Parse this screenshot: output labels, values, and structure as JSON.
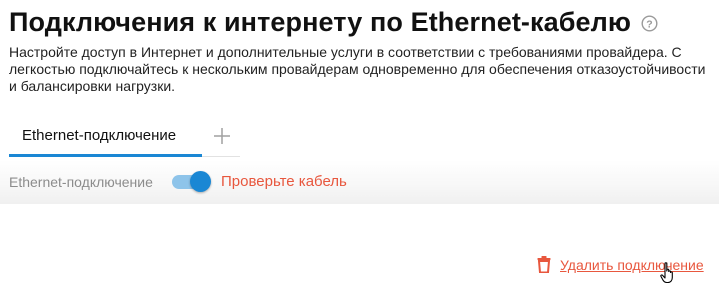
{
  "header": {
    "title": "Подключения к интернету по Ethernet-кабелю",
    "help_icon": "help-circle-icon",
    "description": "Настройте доступ в Интернет и дополнительные услуги в соответствии с требованиями провайдера. С легкостью подключайтесь к нескольким провайдерам одновременно для обеспечения отказоустойчивости и балансировки нагрузки."
  },
  "tabs": {
    "items": [
      {
        "label": "Ethernet-подключение",
        "active": true
      }
    ],
    "add_icon": "plus-icon"
  },
  "connection": {
    "label": "Ethernet-подключение",
    "enabled": true,
    "status_text": "Проверьте кабель"
  },
  "actions": {
    "delete_label": "Удалить подключение",
    "delete_icon": "trash-icon"
  },
  "colors": {
    "accent": "#1a87d4",
    "warning": "#e8573e",
    "muted": "#8c8c8c"
  }
}
